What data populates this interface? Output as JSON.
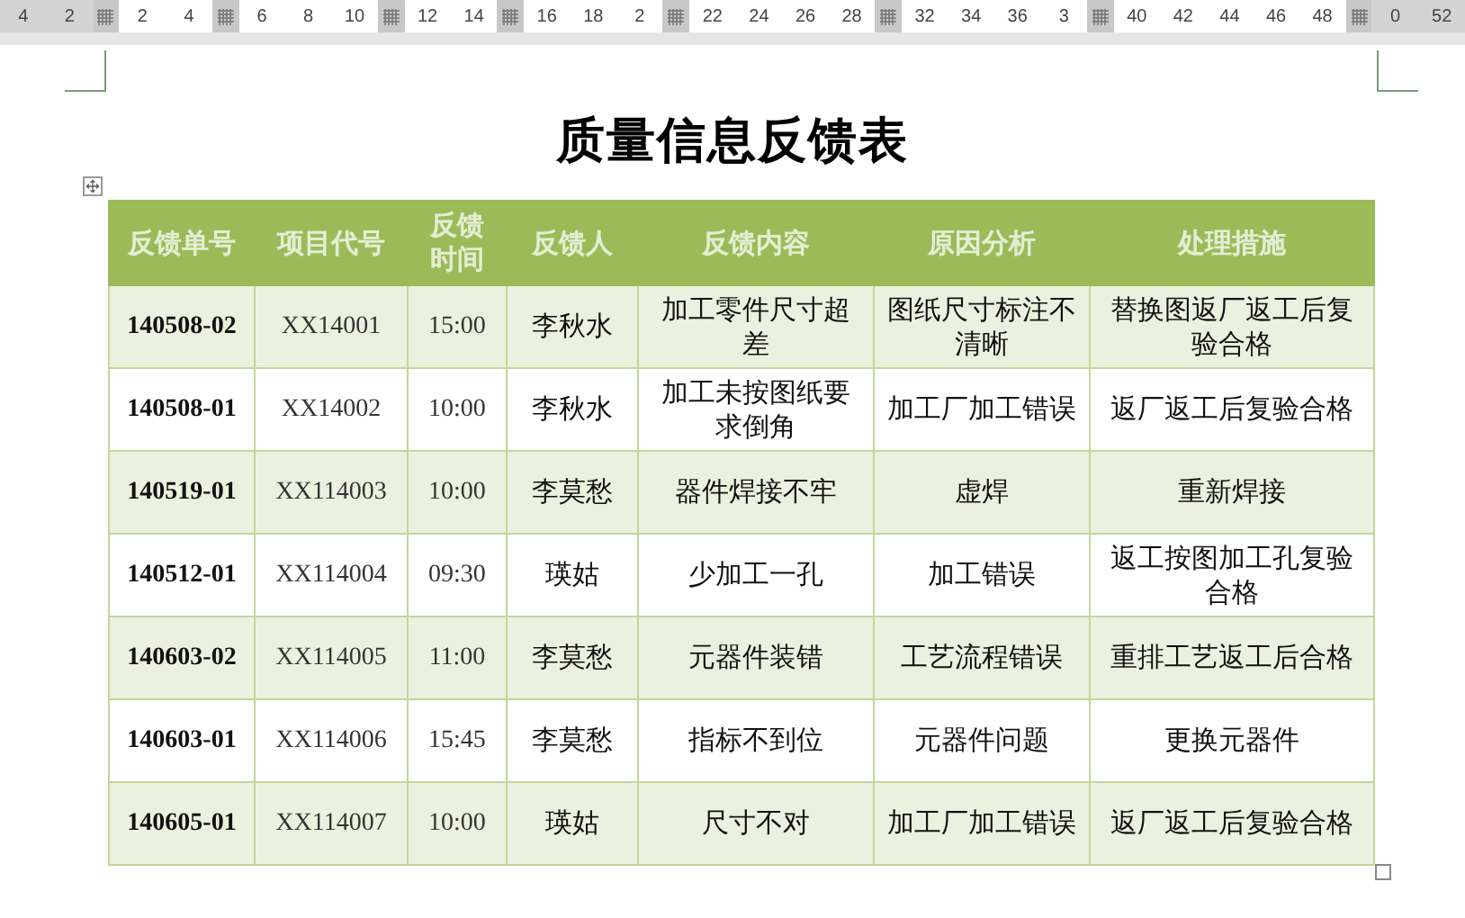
{
  "ruler": {
    "items": [
      {
        "kind": "margin_number",
        "text": "4"
      },
      {
        "kind": "margin_number",
        "text": "2"
      },
      {
        "kind": "marker"
      },
      {
        "kind": "number",
        "text": "2"
      },
      {
        "kind": "number",
        "text": "4"
      },
      {
        "kind": "marker"
      },
      {
        "kind": "number",
        "text": "6"
      },
      {
        "kind": "number",
        "text": "8"
      },
      {
        "kind": "number",
        "text": "10"
      },
      {
        "kind": "marker"
      },
      {
        "kind": "number",
        "text": "12"
      },
      {
        "kind": "number",
        "text": "14"
      },
      {
        "kind": "marker"
      },
      {
        "kind": "number",
        "text": "16"
      },
      {
        "kind": "number",
        "text": "18"
      },
      {
        "kind": "number",
        "text": "2"
      },
      {
        "kind": "marker"
      },
      {
        "kind": "number",
        "text": "22"
      },
      {
        "kind": "number",
        "text": "24"
      },
      {
        "kind": "number",
        "text": "26"
      },
      {
        "kind": "number",
        "text": "28"
      },
      {
        "kind": "marker"
      },
      {
        "kind": "number",
        "text": "32"
      },
      {
        "kind": "number",
        "text": "34"
      },
      {
        "kind": "number",
        "text": "36"
      },
      {
        "kind": "number",
        "text": "3"
      },
      {
        "kind": "marker"
      },
      {
        "kind": "number",
        "text": "40"
      },
      {
        "kind": "number",
        "text": "42"
      },
      {
        "kind": "number",
        "text": "44"
      },
      {
        "kind": "number",
        "text": "46"
      },
      {
        "kind": "number",
        "text": "48"
      },
      {
        "kind": "marker"
      },
      {
        "kind": "margin_number",
        "text": "0"
      },
      {
        "kind": "margin_number",
        "text": "52"
      }
    ]
  },
  "document": {
    "title": "质量信息反馈表",
    "table": {
      "columns": [
        "反馈单号",
        "项目代号",
        "反馈时间",
        "反馈人",
        "反馈内容",
        "原因分析",
        "处理措施"
      ],
      "rows": [
        [
          "140508-02",
          "XX14001",
          "15:00",
          "李秋水",
          "加工零件尺寸超差",
          "图纸尺寸标注不清晰",
          "替换图返厂返工后复验合格"
        ],
        [
          "140508-01",
          "XX14002",
          "10:00",
          "李秋水",
          "加工未按图纸要求倒角",
          "加工厂加工错误",
          "返厂返工后复验合格"
        ],
        [
          "140519-01",
          "XX114003",
          "10:00",
          "李莫愁",
          "器件焊接不牢",
          "虚焊",
          "重新焊接"
        ],
        [
          "140512-01",
          "XX114004",
          "09:30",
          "瑛姑",
          "少加工一孔",
          "加工错误",
          "返工按图加工孔复验合格"
        ],
        [
          "140603-02",
          "XX114005",
          "11:00",
          "李莫愁",
          "元器件装错",
          "工艺流程错误",
          "重排工艺返工后合格"
        ],
        [
          "140603-01",
          "XX114006",
          "15:45",
          "李莫愁",
          "指标不到位",
          "元器件问题",
          "更换元器件"
        ],
        [
          "140605-01",
          "XX114007",
          "10:00",
          "瑛姑",
          "尺寸不对",
          "加工厂加工错误",
          "返厂返工后复验合格"
        ]
      ]
    }
  }
}
